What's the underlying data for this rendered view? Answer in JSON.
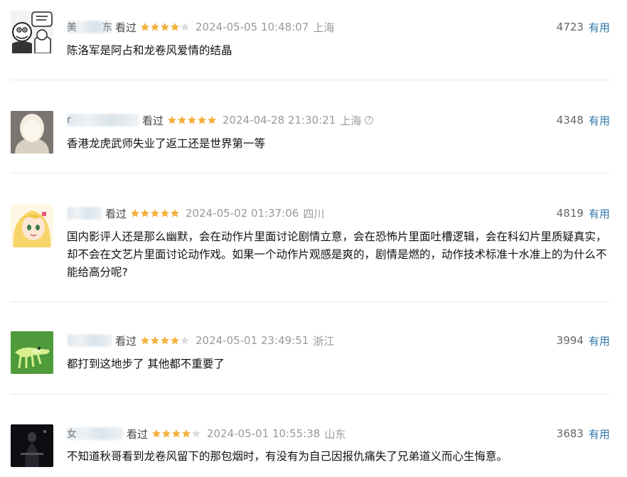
{
  "comments": [
    {
      "user_prefix": "美",
      "user_suffix": "东",
      "watched": "看过",
      "rating": 4,
      "time": "2024-05-05 10:48:07",
      "location": "上海",
      "votes": "4723",
      "useful": "有用",
      "text": "陈洛军是阿占和龙卷风爱情的结晶"
    },
    {
      "user_prefix": "r",
      "user_suffix": "",
      "watched": "看过",
      "rating": 5,
      "time": "2024-04-28 21:30:21",
      "location": "上海",
      "help_icon": "?",
      "votes": "4348",
      "useful": "有用",
      "text": "香港龙虎武师失业了返工还是世界第一等"
    },
    {
      "user_prefix": "",
      "user_suffix": "",
      "watched": "看过",
      "rating": 5,
      "time": "2024-05-02 01:37:06",
      "location": "四川",
      "votes": "4819",
      "useful": "有用",
      "text": "国内影评人还是那么幽默，会在动作片里面讨论剧情立意，会在恐怖片里面吐槽逻辑，会在科幻片里质疑真实，却不会在文艺片里面讨论动作戏。如果一个动作片观感是爽的，剧情是燃的，动作技术标准十水准上的为什么不能给高分呢?"
    },
    {
      "user_prefix": "",
      "user_suffix": "",
      "watched": "看过",
      "rating": 4,
      "time": "2024-05-01 23:49:51",
      "location": "浙江",
      "votes": "3994",
      "useful": "有用",
      "text": "都打到这地步了 其他都不重要了"
    },
    {
      "user_prefix": "女",
      "user_suffix": "",
      "watched": "看过",
      "rating": 4,
      "time": "2024-05-01 10:55:38",
      "location": "山东",
      "votes": "3683",
      "useful": "有用",
      "text": "不知道秋哥看到龙卷风留下的那包烟时，有没有为自己因报仇痛失了兄弟道义而心生悔意。"
    }
  ],
  "colors": {
    "star_on": "#f5b13d",
    "star_off": "#dddddd",
    "link": "#3377aa"
  }
}
